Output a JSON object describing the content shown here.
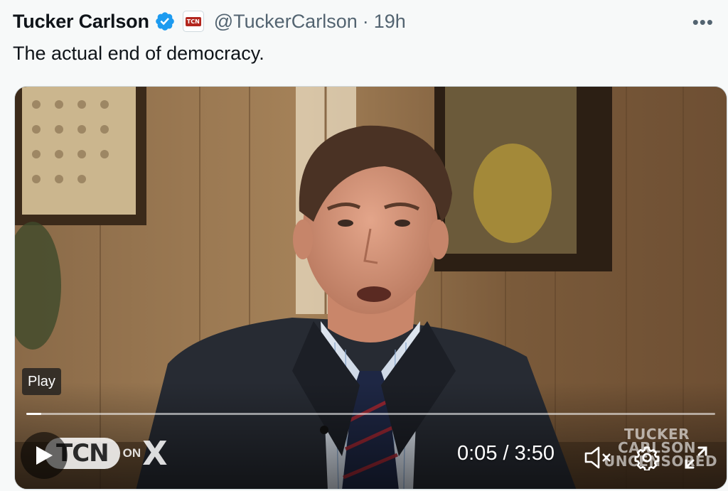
{
  "tweet": {
    "display_name": "Tucker Carlson",
    "verified": true,
    "affiliate_badge_text": "TCN",
    "handle": "@TuckerCarlson",
    "separator": "·",
    "time": "19h",
    "text": "The actual end of democracy.",
    "more_icon": "more-horizontal-icon"
  },
  "video": {
    "tooltip": "Play",
    "progress_fraction": 0.022,
    "time_display": "0:05 / 3:50",
    "logo": {
      "brand": "TCN",
      "on": "ON",
      "x": "X"
    },
    "watermark": [
      "TUCKER",
      "CARLSON",
      "UNCENSORED"
    ],
    "controls": [
      "play-icon",
      "mute-icon",
      "settings-icon",
      "fullscreen-icon"
    ]
  },
  "colors": {
    "verified_blue": "#1d9bf0",
    "secondary_text": "#536471",
    "badge_red": "#b3261e"
  }
}
